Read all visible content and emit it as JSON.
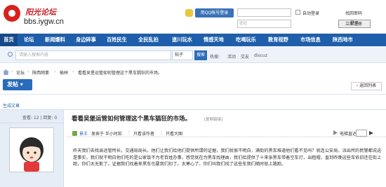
{
  "header": {
    "site_name": "阳光论坛",
    "site_url": "bbs.iygw.cn",
    "qq_login": "用QQ帐号登录",
    "password_placeholder": "密码",
    "auto_login": "自动登录",
    "forgot": "找回密码",
    "login": "登录",
    "register": "立即注册"
  },
  "nav": [
    "首页",
    "论坛",
    "新闻爆料",
    "身边碎事",
    "百姓民生",
    "全民乱拍",
    "遂川玩水",
    "情感天地",
    "吃喝玩乐",
    "教育视野",
    "市场信息",
    "陕西地市"
  ],
  "search": {
    "placeholder": "请输入搜索内容",
    "type": "帖子",
    "button": "搜索",
    "hot_label": "热搜:",
    "hot": [
      "活动",
      "交友",
      "discuz"
    ]
  },
  "breadcrumb": [
    "论坛",
    "陕西网事",
    "榆林",
    "看看吴堡运管如何管理这个黑车猖狂的市场。"
  ],
  "actions": {
    "post": "发帖",
    "back": "返回列表"
  },
  "source": "生成文章",
  "post": {
    "stats": "查看: 12 | 回复: 0",
    "title": "看看吴堡运管如何管理这个黑车猖狂的市场。",
    "copy_link": "[复制链接]",
    "author": "景王",
    "posted": "发表于 半小时前",
    "only_author": "只看该作者",
    "only_big": "只看大图",
    "floor": "电梯直达",
    "body": "昨天我们去找县运管所长，交通局局长。他们让我们给他们提供所谓的证据，我们就很不明白，满街的黑车难道他们看不见吗？就连公安局，派出所的民警都说这是事实，我们就不明白他们吃的是公家饭不为老百姓办事，感觉就在为黑车找理由，我们给提供了十来张黑车带着空车灯，出租帽，直到昨晚这些车依旧还在街上跑，你们太无能了。证据我们找着来黑车也要我们扣了。太寒心了。你们叫我们找了这些车我们随时就上路跑。"
  },
  "colors": {
    "nav": "#1e5eab",
    "brand": "#d8211c"
  }
}
